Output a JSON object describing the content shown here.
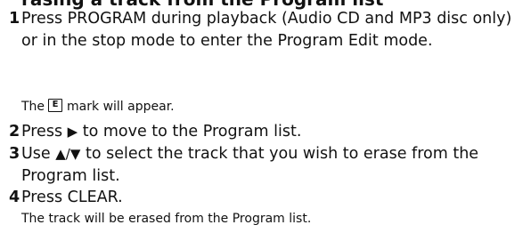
{
  "heading": "rasing a track from the Program list",
  "steps": [
    {
      "number": "1",
      "text": "Press PROGRAM during playback (Audio CD and MP3 disc only) or in the stop mode to enter the Program Edit mode."
    },
    {
      "number": "2",
      "before": "Press ",
      "icon": "play-triangle-icon",
      "glyph": "▶",
      "after": " to move to the Program list."
    },
    {
      "number": "3",
      "before": "Use ",
      "icon": "up-down-arrows-icon",
      "glyph": "▲/▼",
      "after": " to select the track that you wish to erase from the Program list."
    },
    {
      "number": "4",
      "text": "Press CLEAR."
    }
  ],
  "notes": {
    "mark_before": "The",
    "mark_letter": "E",
    "mark_icon": "program-edit-mark-icon",
    "mark_after": "mark will appear.",
    "erased": "The track will be erased from the Program list."
  }
}
